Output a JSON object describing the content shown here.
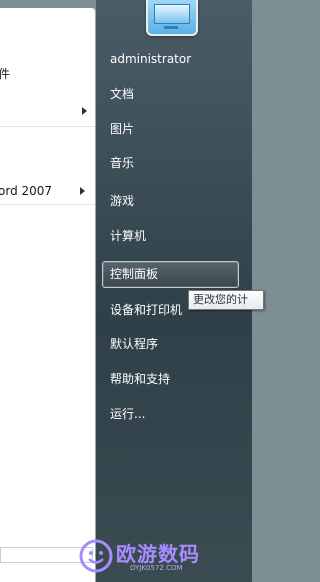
{
  "left_pane": {
    "items": [
      {
        "label": "件",
        "has_arrow": false
      },
      {
        "label": "",
        "has_arrow": true
      },
      {
        "label": "ord 2007",
        "has_arrow": true
      }
    ]
  },
  "right_pane": {
    "items": [
      {
        "label": "administrator"
      },
      {
        "label": "文档"
      },
      {
        "label": "图片"
      },
      {
        "label": "音乐"
      },
      {
        "label": "游戏"
      },
      {
        "label": "计算机"
      },
      {
        "label": "控制面板"
      },
      {
        "label": "设备和打印机"
      },
      {
        "label": "默认程序"
      },
      {
        "label": "帮助和支持"
      },
      {
        "label": "运行..."
      }
    ],
    "tooltip": "更改您的计"
  },
  "watermark": {
    "brand": "欧游数码",
    "url": "OYJK0572.COM"
  }
}
